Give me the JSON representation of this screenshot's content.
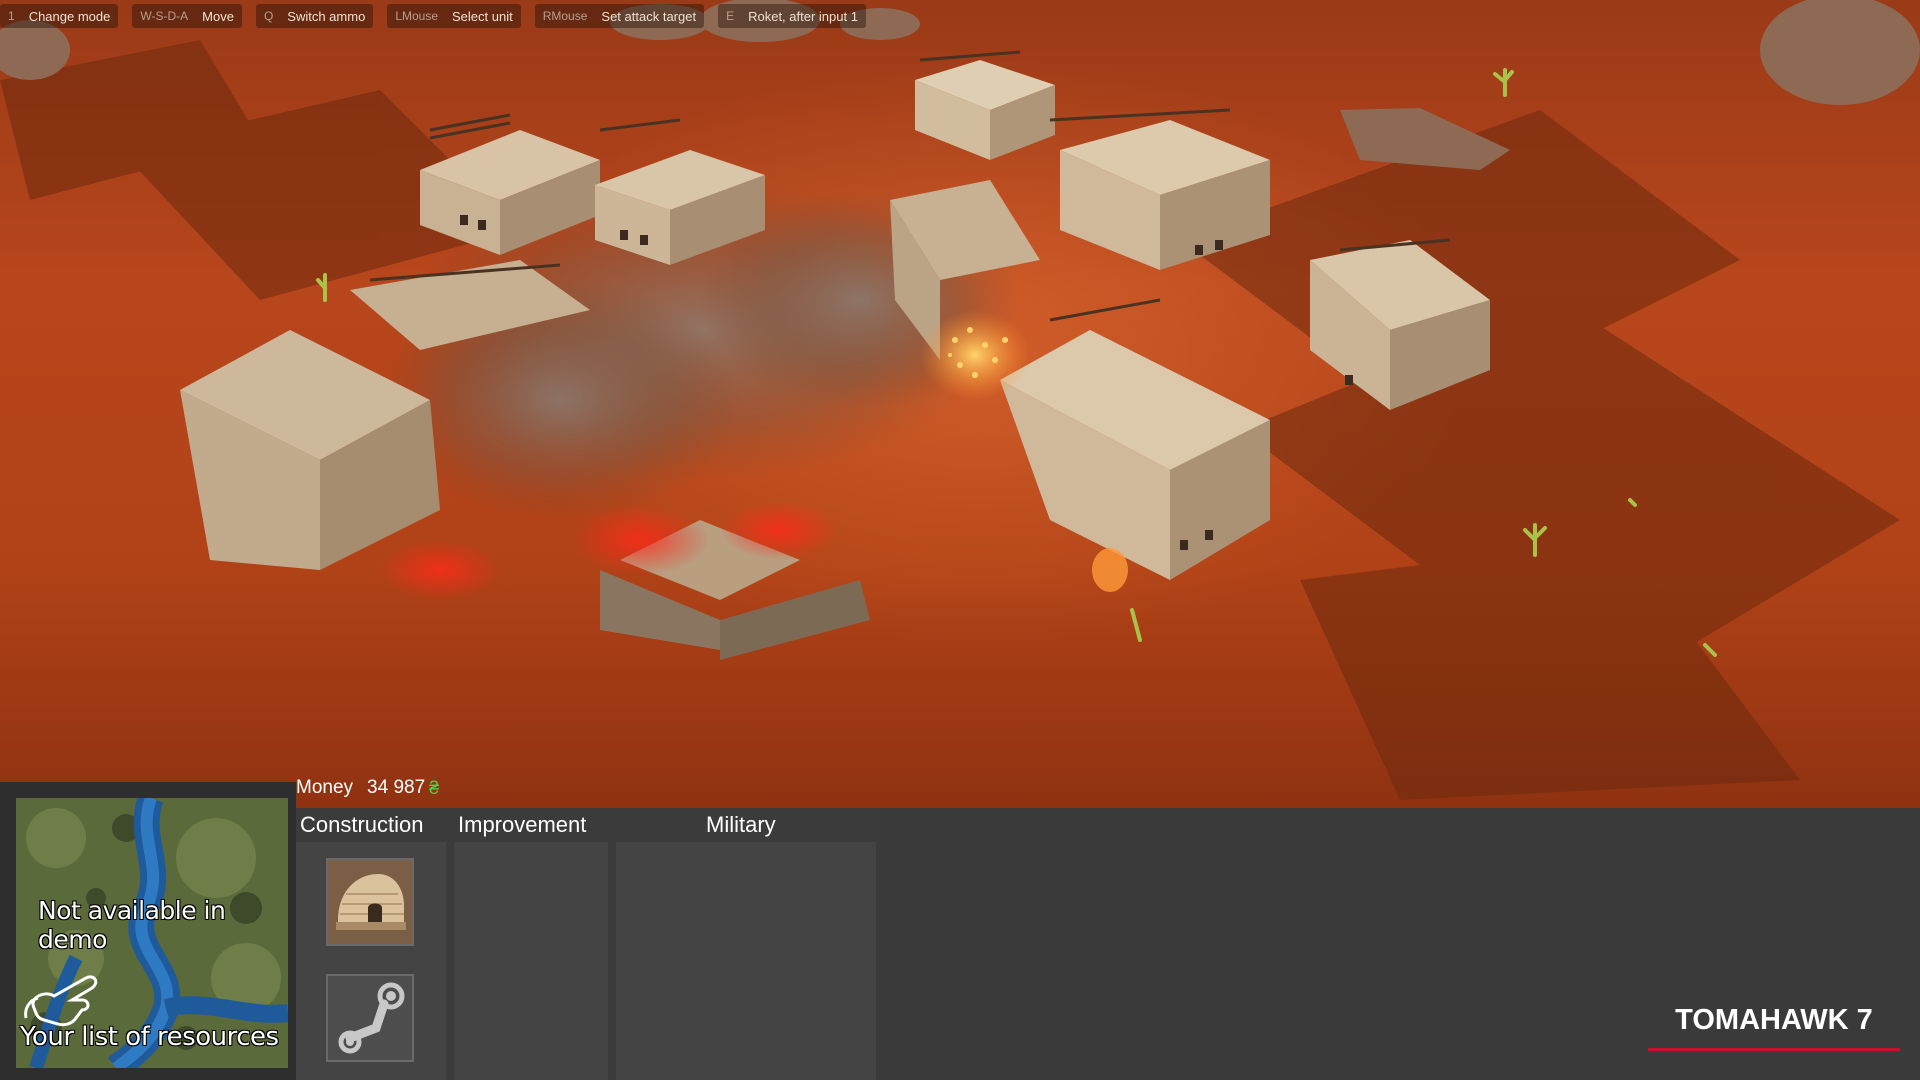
{
  "hints": [
    {
      "key": "1",
      "label": "Change mode"
    },
    {
      "key": "W-S-D-A",
      "label": "Move"
    },
    {
      "key": "Q",
      "label": "Switch ammo"
    },
    {
      "key": "LMouse",
      "label": "Select unit"
    },
    {
      "key": "RMouse",
      "label": "Set attack target"
    },
    {
      "key": "E",
      "label": "Roket, after input 1"
    }
  ],
  "money": {
    "label": "Money",
    "value": "34 987",
    "currency_symbol": "₴",
    "currency_color": "#49d24b"
  },
  "minimap": {
    "notice": "Not available in demo",
    "resources_hint": "Your list of resources",
    "hand_icon": "pointing-hand-icon"
  },
  "tabs": [
    {
      "id": "construction",
      "label": "Construction"
    },
    {
      "id": "improvement",
      "label": "Improvement"
    },
    {
      "id": "military",
      "label": "Military"
    }
  ],
  "construction_slots": [
    {
      "icon": "hut-icon"
    },
    {
      "icon": "steam-icon"
    }
  ],
  "brand": {
    "name": "TOMAHAWK 7",
    "accent_color": "#c8102e"
  },
  "colors": {
    "panel_bg": "#3b3b3b",
    "column_bg": "#444444",
    "terrain": "#b8461c"
  }
}
